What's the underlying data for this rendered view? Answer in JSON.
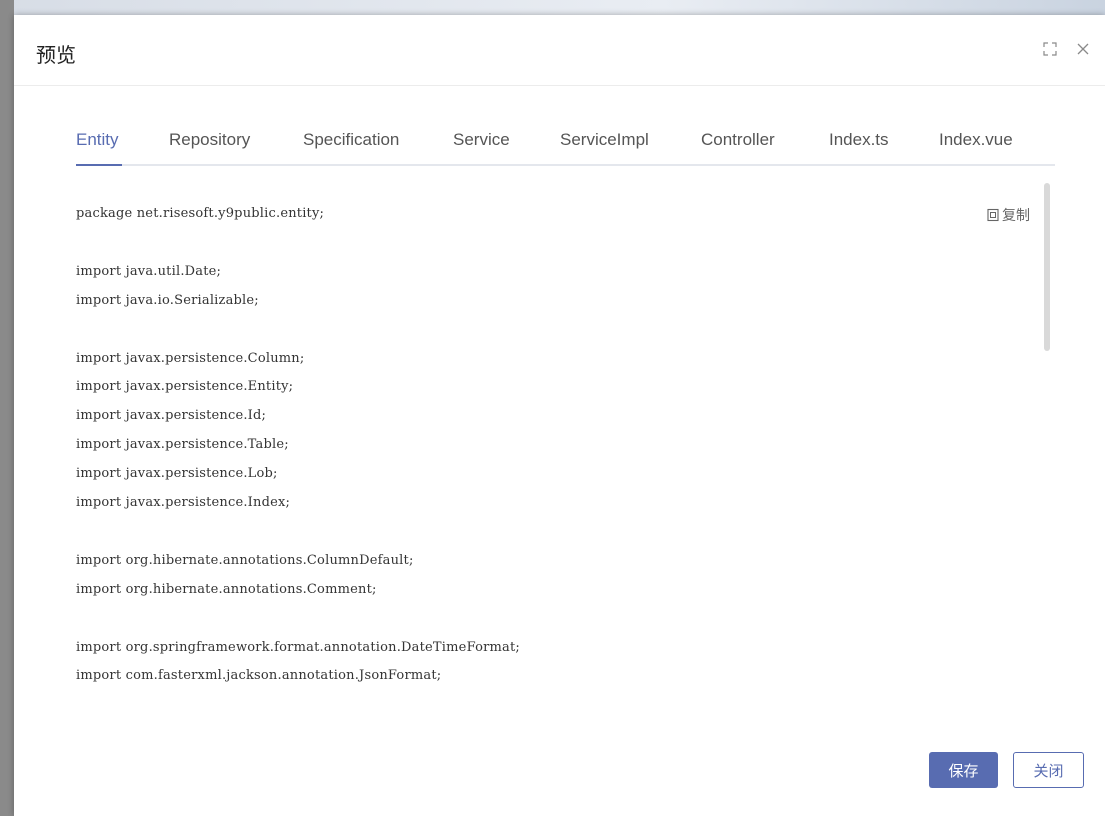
{
  "dialog": {
    "title": "预览"
  },
  "tabs": [
    {
      "label": "Entity",
      "active": true
    },
    {
      "label": "Repository",
      "active": false
    },
    {
      "label": "Specification",
      "active": false
    },
    {
      "label": "Service",
      "active": false
    },
    {
      "label": "ServiceImpl",
      "active": false
    },
    {
      "label": "Controller",
      "active": false
    },
    {
      "label": "Index.ts",
      "active": false
    },
    {
      "label": "Index.vue",
      "active": false
    }
  ],
  "code": {
    "copy_label": "复制",
    "lines": [
      "package net.risesoft.y9public.entity;",
      "",
      "import java.util.Date;",
      "import java.io.Serializable;",
      "",
      "import javax.persistence.Column;",
      "import javax.persistence.Entity;",
      "import javax.persistence.Id;",
      "import javax.persistence.Table;",
      "import javax.persistence.Lob;",
      "import javax.persistence.Index;",
      "",
      "import org.hibernate.annotations.ColumnDefault;",
      "import org.hibernate.annotations.Comment;",
      "",
      "import org.springframework.format.annotation.DateTimeFormat;",
      "import com.fasterxml.jackson.annotation.JsonFormat;"
    ]
  },
  "footer": {
    "save_label": "保存",
    "close_label": "关闭"
  },
  "colors": {
    "accent": "#586cb1",
    "text": "#333333"
  },
  "icons": {
    "fullscreen": "fullscreen-icon",
    "close": "close-icon",
    "copy": "copy-icon"
  }
}
